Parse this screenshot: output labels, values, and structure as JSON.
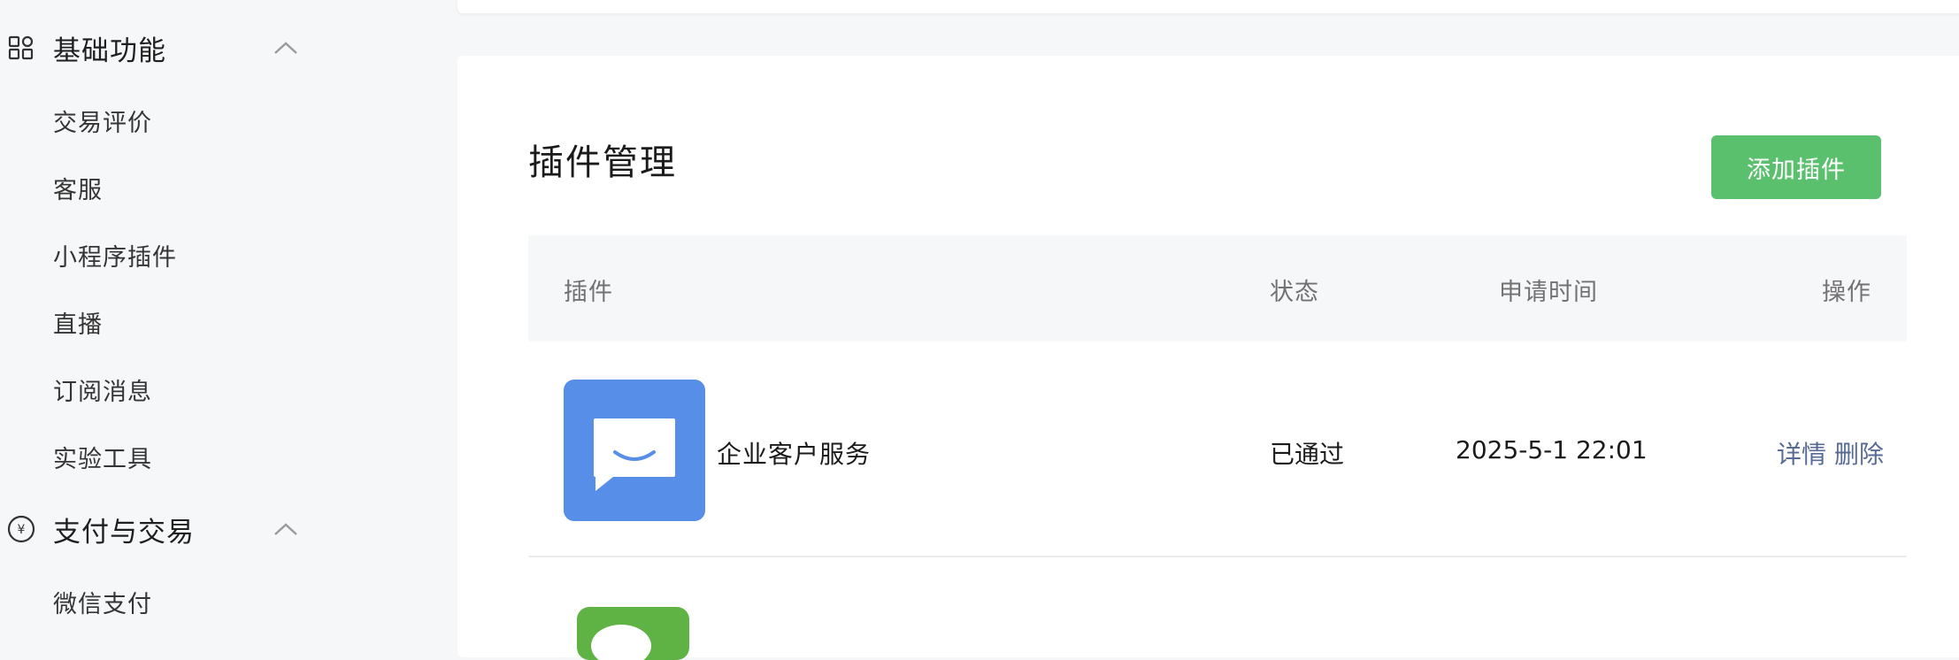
{
  "sidebar": {
    "groups": [
      {
        "label": "基础功能",
        "icon": "grid-apps-icon",
        "expanded": true,
        "items": [
          "交易评价",
          "客服",
          "小程序插件",
          "直播",
          "订阅消息",
          "实验工具"
        ]
      },
      {
        "label": "支付与交易",
        "icon": "yuan-circle-icon",
        "expanded": true,
        "items": [
          "微信支付"
        ]
      }
    ]
  },
  "main": {
    "title": "插件管理",
    "add_button": "添加插件",
    "table": {
      "columns": [
        "插件",
        "状态",
        "申请时间",
        "操作"
      ],
      "rows": [
        {
          "icon": "chat-smile-icon",
          "icon_color": "#578ee7",
          "name": "企业客户服务",
          "status": "已通过",
          "applied_at": "2025-5-1 22:01",
          "actions": [
            "详情",
            "删除"
          ]
        },
        {
          "icon": "green-app-icon",
          "icon_color": "#5fb244"
        }
      ]
    }
  },
  "colors": {
    "accent_green": "#5bc06e",
    "link": "#576b95",
    "plugin_icon_blue": "#578ee7"
  }
}
